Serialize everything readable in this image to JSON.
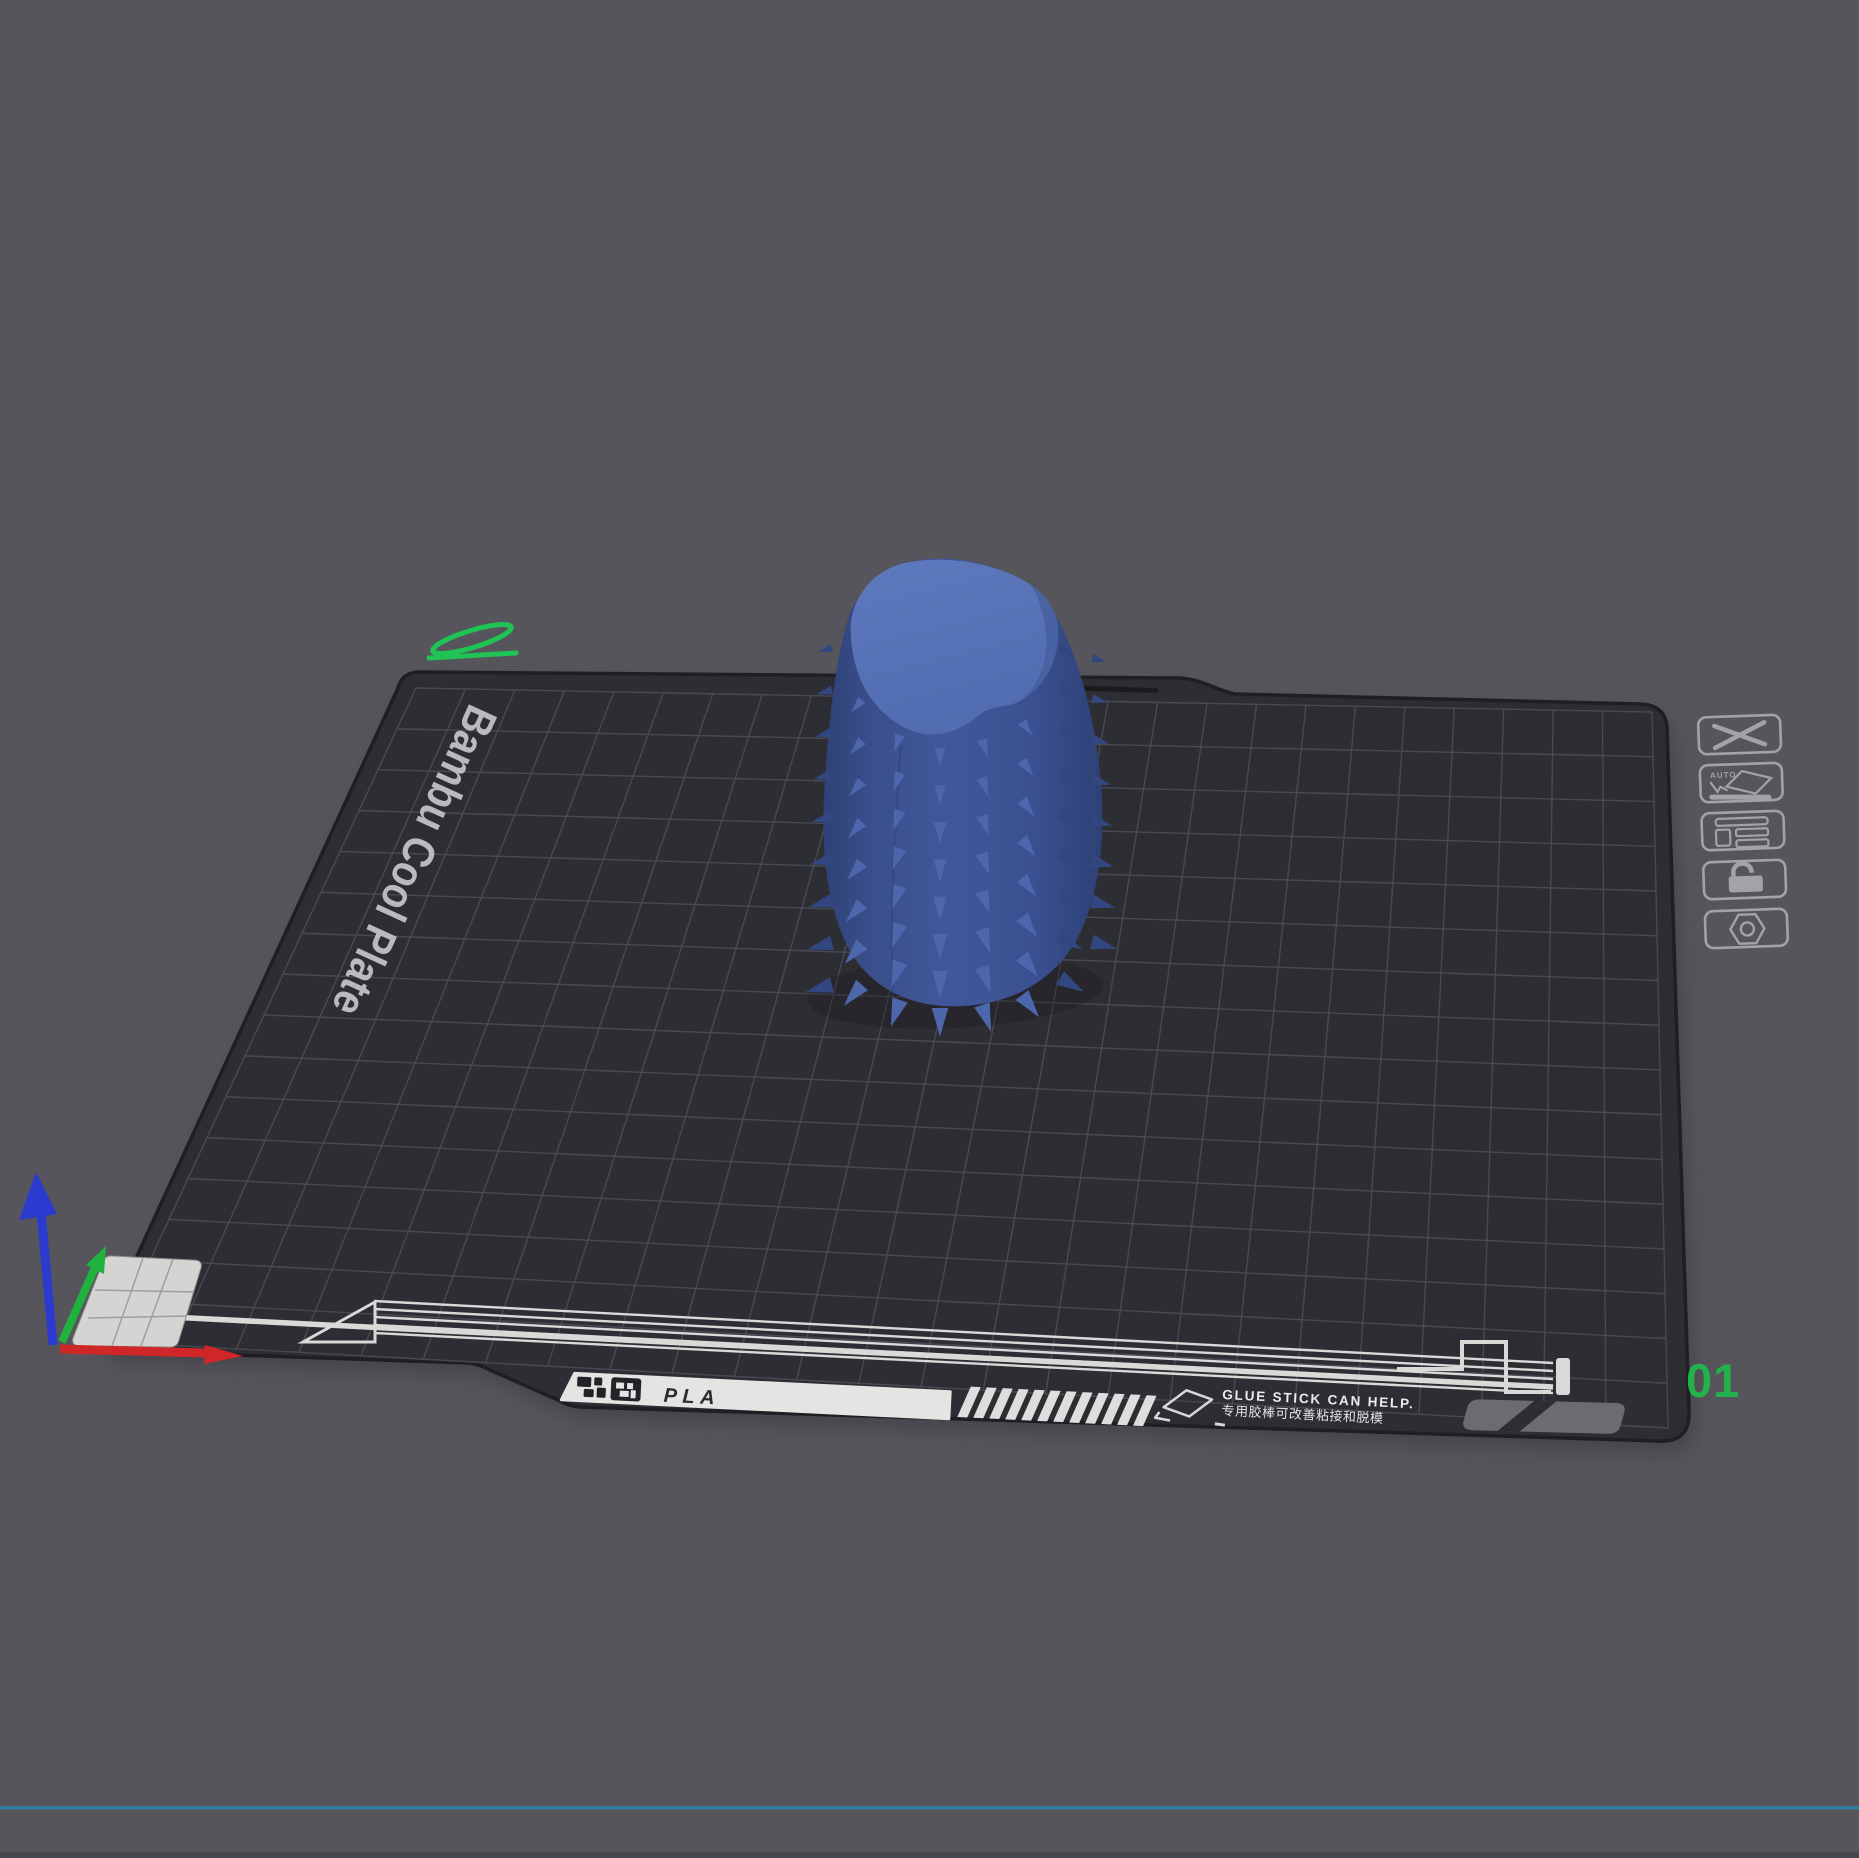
{
  "viewport": {
    "background_color": "#55555b",
    "divider_color": "#2e80a0",
    "bottom_strip_color": "#47474d"
  },
  "plate": {
    "label": "Bambu Cool Plate",
    "filament": "PLA",
    "number": "01",
    "number_color": "#22b24c",
    "glue_hint_en": "GLUE STICK CAN HELP.",
    "glue_hint_zh": "专用胶棒可改善粘接和脱模",
    "surface_color": "#2d2d34",
    "grid_color": "#4d4d56",
    "edge_color": "#1e1e23",
    "strip_color": "#e4e4e2",
    "print_line_color": "#d9d9d7"
  },
  "model": {
    "body_color": "#3d5494",
    "top_color": "#5b76ba",
    "spike_color": "#4d67ad",
    "edge_spike_color": "#32477f"
  },
  "axes": {
    "x_color": "#cf2727",
    "y_color": "#1fb23c",
    "z_color": "#2b3bd0",
    "origin_marker_color": "#d4d4d2"
  },
  "marker": {
    "green_indicator_color": "#1fc454"
  },
  "toolbar": {
    "icon_color": "#a2a2a8",
    "auto_label": "AUTO",
    "buttons": [
      {
        "name": "delete-plate",
        "icon": "x-icon"
      },
      {
        "name": "auto-lay-flat",
        "icon": "auto-flatten-icon"
      },
      {
        "name": "arrange-plate",
        "icon": "layout-icon"
      },
      {
        "name": "lock-plate",
        "icon": "unlocked-padlock-icon"
      },
      {
        "name": "plate-settings",
        "icon": "hexagon-nut-icon"
      }
    ]
  }
}
